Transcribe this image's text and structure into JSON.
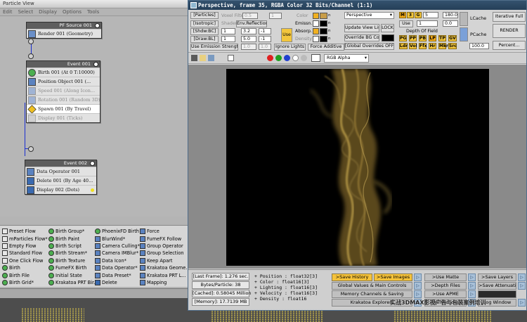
{
  "particle_view": {
    "title": "Particle View",
    "menu": [
      "Edit",
      "Select",
      "Display",
      "Options",
      "Tools"
    ],
    "source_node": {
      "header": "PF Source 001",
      "ops": [
        "Render 001 (Geometry)"
      ]
    },
    "event1": {
      "header": "Event 001",
      "ops": [
        "Birth 001 (At 0 T:10000)",
        "Position Object 001 (...",
        "Speed 001 (Along Icon...",
        "Rotation 001 (Random 3D)",
        "Spawn 001 (By Travel)",
        "Display 001 (Ticks)"
      ]
    },
    "event2": {
      "header": "Event 002",
      "ops": [
        "Data Operator 001",
        "Delete 001 (By Age 40...",
        "Display 002 (Dots)"
      ]
    },
    "depot": {
      "col1": [
        "Preset Flow",
        "mParticles Flow*",
        "Empty Flow",
        "Standard Flow",
        "One Click Flow",
        "Birth",
        "Birth File",
        "Birth Grid*"
      ],
      "col2": [
        "Birth Group*",
        "Birth Paint",
        "Birth Script",
        "Birth Stream*",
        "Birth Texture",
        "FumeFX Birth",
        "Initial State",
        "Krakatoa PRT Bir..."
      ],
      "col3": [
        "PhoenixFD Birth",
        "BlurWind*",
        "Camera Culling*",
        "Camera IMBlur*",
        "Data Icon*",
        "Data Operator*",
        "Data Preset*",
        "Delete"
      ],
      "col4": [
        "Force",
        "FumeFX Follow",
        "Group Operator",
        "Group Selection",
        "Keep Apart",
        "Krakatoa Geome...",
        "Krakatoa PRT L...",
        "Mapping"
      ]
    }
  },
  "vfb": {
    "title": "Perspective, frame 35, RGBA Color 32 Bits/Channel (1:1)",
    "left_labels": [
      "[Particles]",
      "[Isotropic]",
      "[Shdw:BC]",
      "[Draw:BL]",
      "Use Emission Strength"
    ],
    "voxel_filter_label": "Voxel Filter",
    "shader_label": "Shader",
    "env_reflection_label": "Env.Reflection",
    "use_label": "Use",
    "spin_a": [
      "0.5",
      "1",
      "3.2",
      "5.0",
      "1.0",
      "1.0"
    ],
    "spin_b": [
      "1",
      "1",
      "-1",
      "-1"
    ],
    "color_labels": [
      "Color",
      "Emissn.",
      "Absorp.",
      "Density"
    ],
    "ignore_lights": "Ignore Lights",
    "force_additive": "Force Additive",
    "view_select": "Perspective",
    "update_view_list": "Update View List",
    "lock": "LOCK",
    "override_bg": "Override BG Color",
    "global_overrides": "[Global Overrides OFF]",
    "m_btn": "M",
    "num3": "3",
    "g_btn": "G",
    "spin_5": "5",
    "spin_180": "180.0",
    "use_small": "Use",
    "spin_1": "1",
    "spin_0": "0.0",
    "depth_of_field": "Depth Of Field",
    "pg_row": [
      "PG",
      "PP",
      "PB",
      "LP",
      "TP",
      "GV"
    ],
    "ldr_row": [
      "Ldr",
      "Vol",
      "Ffx",
      "Hr",
      "Mkr",
      "Src"
    ],
    "spin_100": "100.0",
    "lcache": "LCache",
    "pcache": "PCache",
    "iterative_full": "Iterative Full",
    "render": "RENDER",
    "percent": "Percent...",
    "channel_select": "RGB Alpha",
    "stats": {
      "last_frame": "[Last Frame]: 1.276 sec.",
      "bytes_particle": "Bytes/Particle: 38",
      "cached": "[Cached]: 0.58045 Million",
      "memory": "[Memory]: 17.7139 MB"
    },
    "channels": [
      "+ Position :  float32[3]",
      "+ Color :  float16[3]",
      "+ Lighting :  float16[3]",
      "+ Velocity :  float16[3]",
      "+ Density :  float16"
    ],
    "save_history": ">Save History",
    "save_images": ">Save Images",
    "use_matte": ">Use Matte",
    "save_layers": ">Save Layers",
    "global_values": "Global Values & Main Controls",
    "depth_files": ">Depth Files",
    "save_attenuation": ">Save Attenuation",
    "memory_channels": "Memory Channels & Saving",
    "use_apme": ">Use APME",
    "krakatoa_explorers": "Krakatoa Explorers",
    "preferences": "Preferences",
    "log_window": "Log Window"
  },
  "watermark": "实战3DMAX影视广告与包装案例培训"
}
